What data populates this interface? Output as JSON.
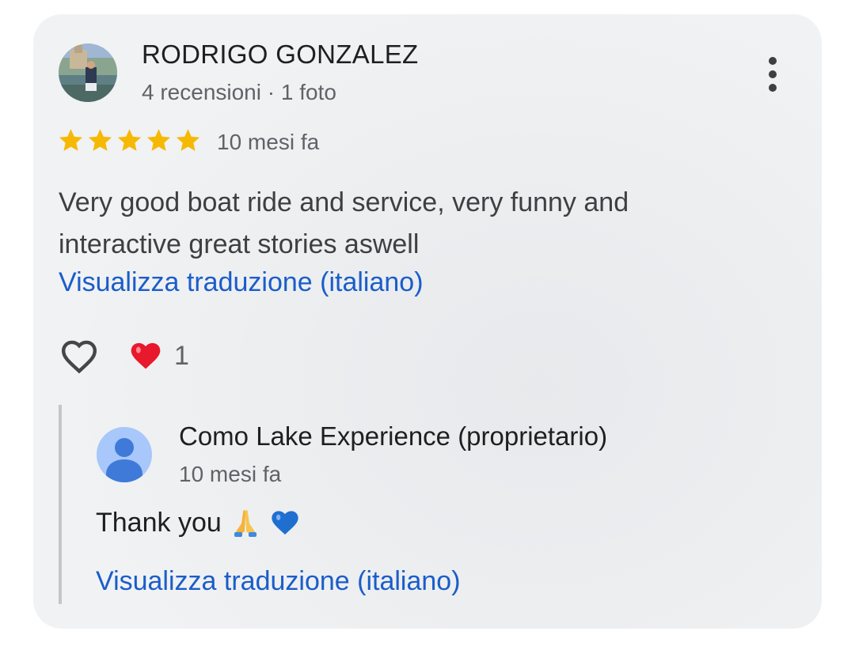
{
  "review": {
    "author_name": "RODRIGO GONZALEZ",
    "author_meta": "4 recensioni · 1 foto",
    "rating": 5,
    "rating_max": 5,
    "time_ago": "10 mesi fa",
    "text": "Very good boat ride and service, very funny and interactive great stories aswell",
    "translate_label": "Visualizza traduzione (italiano)",
    "reaction_count": "1",
    "icons": {
      "menu": "more-vert-icon",
      "like": "heart-outline-icon",
      "reaction": "red-heart-emoji"
    }
  },
  "owner_reply": {
    "name": "Como Lake Experience (proprietario)",
    "time_ago": "10 mesi fa",
    "text": "Thank you",
    "emojis": [
      "folded-hands-emoji",
      "blue-heart-emoji"
    ],
    "translate_label": "Visualizza traduzione (italiano)"
  },
  "colors": {
    "star": "#f6b903",
    "link": "#1a5dc9",
    "reply_bar": "#c4c7c9",
    "owner_avatar_bg": "#a8c7fa",
    "owner_avatar_fg": "#3f7ad8"
  }
}
